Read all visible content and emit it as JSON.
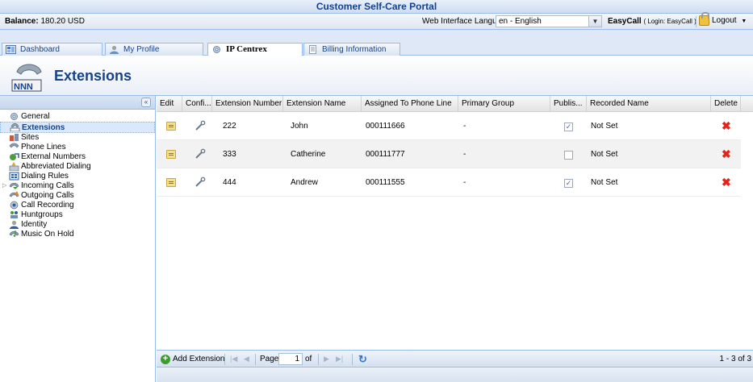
{
  "app": {
    "title": "Customer Self-Care Portal"
  },
  "topbar": {
    "balance_label": "Balance:",
    "balance_value": "180.20 USD",
    "language_label": "Web Interface Language:",
    "language_value": "en - English",
    "user_name": "EasyCall",
    "login_text": "( Login: EasyCall )",
    "logout_label": "Logout"
  },
  "tabs": [
    {
      "label": "Dashboard"
    },
    {
      "label": "My Profile"
    },
    {
      "label": "IP Centrex",
      "active": true
    },
    {
      "label": "Billing Information"
    }
  ],
  "header": {
    "title": "Extensions"
  },
  "sidebar": {
    "items": [
      {
        "label": "General",
        "icon": "gear-icon"
      },
      {
        "label": "Extensions",
        "icon": "phone-icon",
        "selected": true
      },
      {
        "label": "Sites",
        "icon": "sites-icon"
      },
      {
        "label": "Phone Lines",
        "icon": "phone-lines-icon"
      },
      {
        "label": "External Numbers",
        "icon": "external-numbers-icon"
      },
      {
        "label": "Abbreviated Dialing",
        "icon": "abbreviated-dialing-icon"
      },
      {
        "label": "Dialing Rules",
        "icon": "dialing-rules-icon"
      },
      {
        "label": "Incoming Calls",
        "icon": "incoming-calls-icon",
        "expandable": true
      },
      {
        "label": "Outgoing Calls",
        "icon": "outgoing-calls-icon"
      },
      {
        "label": "Call Recording",
        "icon": "call-recording-icon"
      },
      {
        "label": "Huntgroups",
        "icon": "huntgroups-icon"
      },
      {
        "label": "Identity",
        "icon": "identity-icon"
      },
      {
        "label": "Music On Hold",
        "icon": "music-on-hold-icon"
      }
    ]
  },
  "grid": {
    "columns": [
      "Edit",
      "Confi...",
      "Extension Number",
      "Extension Name",
      "Assigned To Phone Line",
      "Primary Group",
      "Publis...",
      "Recorded Name",
      "Delete"
    ],
    "rows": [
      {
        "number": "222",
        "name": "John",
        "phone_line": "000111666",
        "group": "-",
        "published": true,
        "recorded": "Not Set"
      },
      {
        "number": "333",
        "name": "Catherine",
        "phone_line": "000111777",
        "group": "-",
        "published": false,
        "recorded": "Not Set"
      },
      {
        "number": "444",
        "name": "Andrew",
        "phone_line": "000111555",
        "group": "-",
        "published": true,
        "recorded": "Not Set"
      }
    ]
  },
  "footer": {
    "add_label": "Add Extension",
    "page_label": "Page",
    "page_value": "1",
    "of_label": "of",
    "range_text": "1 - 3 of 3"
  },
  "colors": {
    "accent": "#15428b",
    "border": "#99bbe8",
    "delete": "#e1251b"
  }
}
